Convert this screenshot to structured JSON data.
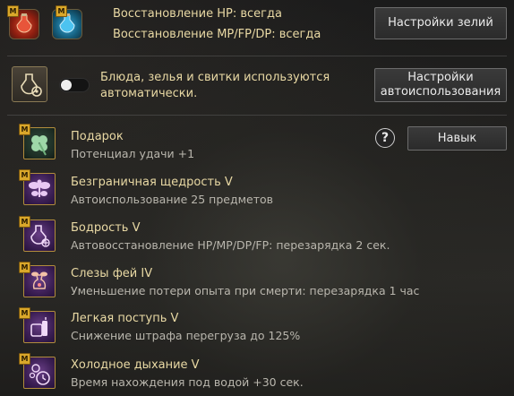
{
  "top": {
    "hp_label": "Восстановление HP: всегда",
    "mp_label": "Восстановление MP/FP/DP: всегда",
    "potion_settings_button": "Настройки зелий"
  },
  "auto": {
    "label_line1": "Блюда, зелья и свитки используются",
    "label_line2": "автоматически.",
    "settings_button_line1": "Настройки",
    "settings_button_line2": "автоиспользования",
    "toggle_on": false
  },
  "help_label": "?",
  "skill_button": "Навык",
  "badge_letter": "M",
  "skills": [
    {
      "title": "Подарок",
      "desc": "Потенциал удачи +1",
      "icon": "clover-icon"
    },
    {
      "title": "Безграничная щедрость V",
      "desc": "Автоиспользование 25 предметов",
      "icon": "fairy-icon"
    },
    {
      "title": "Бодрость V",
      "desc": "Автовосстановление HP/MP/DP/FP: перезарядка 2 сек.",
      "icon": "potion-flask-icon"
    },
    {
      "title": "Слезы фей IV",
      "desc": "Уменьшение потери опыта при смерти: перезарядка 1 час",
      "icon": "fairy-tear-icon"
    },
    {
      "title": "Легкая поступь V",
      "desc": "Снижение штрафа перегруза до 125%",
      "icon": "weight-icon"
    },
    {
      "title": "Холодное дыхание V",
      "desc": "Время нахождения под водой +30 сек.",
      "icon": "bubble-clock-icon"
    }
  ],
  "colors": {
    "gold": "#e9d9a4",
    "badge": "#d9a72a",
    "icon_border": "#b28d3c"
  }
}
